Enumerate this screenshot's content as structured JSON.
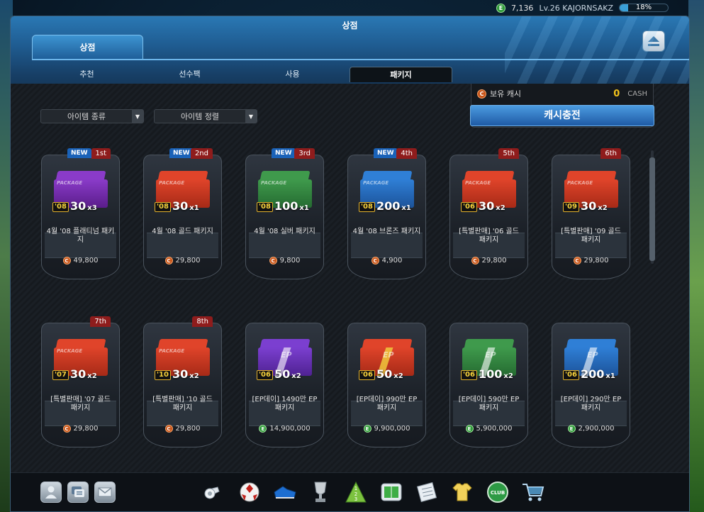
{
  "status": {
    "ep_coin_label": "E",
    "ep_amount": "7,136",
    "level_text": "Lv.26 KAJORNSAKZ",
    "exp_percent_text": "18%",
    "exp_fraction": 0.18
  },
  "window": {
    "title": "상점",
    "main_tab": "상점"
  },
  "sub_tabs": [
    {
      "label": "추천"
    },
    {
      "label": "선수팩"
    },
    {
      "label": "사용"
    },
    {
      "label": "패키지"
    }
  ],
  "filters": {
    "item_type": "아이템 종류",
    "item_sort": "아이템 정렬",
    "arrow": "▼"
  },
  "cash": {
    "coin_label": "C",
    "label": "보유 캐시",
    "amount": "0",
    "unit": "CASH",
    "charge_button": "캐시충전"
  },
  "products": [
    {
      "new": "NEW",
      "rank": "1st",
      "name": "4월 '08 플래티넘 패키지",
      "price": "49,800",
      "currency": "C",
      "year": "'08",
      "qty": "30",
      "mult": "x3",
      "color": "#8a3bc9",
      "color_dark": "#5a1d8a",
      "style": "package"
    },
    {
      "new": "NEW",
      "rank": "2nd",
      "name": "4월 '08 골드 패키지",
      "price": "29,800",
      "currency": "C",
      "year": "'08",
      "qty": "30",
      "mult": "x1",
      "color": "#e0442a",
      "color_dark": "#a62a17",
      "style": "package"
    },
    {
      "new": "NEW",
      "rank": "3rd",
      "name": "4월 '08 실버 패키지",
      "price": "9,800",
      "currency": "C",
      "year": "'08",
      "qty": "100",
      "mult": "x1",
      "color": "#3f9a4c",
      "color_dark": "#256b31",
      "style": "package"
    },
    {
      "new": "NEW",
      "rank": "4th",
      "name": "4월 '08 브론즈 패키지",
      "price": "4,900",
      "currency": "C",
      "year": "'08",
      "qty": "200",
      "mult": "x1",
      "color": "#2f7fd6",
      "color_dark": "#1c539a",
      "style": "package"
    },
    {
      "new": "",
      "rank": "5th",
      "name": "[특별판매] '06 골드 패키지",
      "price": "29,800",
      "currency": "C",
      "year": "'06",
      "qty": "30",
      "mult": "x2",
      "color": "#e0442a",
      "color_dark": "#a62a17",
      "style": "package"
    },
    {
      "new": "",
      "rank": "6th",
      "name": "[특별판매] '09 골드 패키지",
      "price": "29,800",
      "currency": "C",
      "year": "'09",
      "qty": "30",
      "mult": "x2",
      "color": "#e0442a",
      "color_dark": "#a62a17",
      "style": "package"
    },
    {
      "new": "",
      "rank": "7th",
      "name": "[특별판매] '07 골드 패키지",
      "price": "29,800",
      "currency": "C",
      "year": "'07",
      "qty": "30",
      "mult": "x2",
      "color": "#e0442a",
      "color_dark": "#a62a17",
      "style": "package"
    },
    {
      "new": "",
      "rank": "8th",
      "name": "[특별판매] '10 골드 패키지",
      "price": "29,800",
      "currency": "C",
      "year": "'10",
      "qty": "30",
      "mult": "x2",
      "color": "#e0442a",
      "color_dark": "#a62a17",
      "style": "package"
    },
    {
      "new": "",
      "rank": "",
      "name": "[EP데이] 1490만 EP 패키지",
      "price": "14,900,000",
      "currency": "E",
      "year": "'06",
      "qty": "50",
      "mult": "x2",
      "color": "#7b3fd0",
      "color_dark": "#4f2292",
      "style": "ep"
    },
    {
      "new": "",
      "rank": "",
      "name": "[EP데이] 990만 EP 패키지",
      "price": "9,900,000",
      "currency": "E",
      "year": "'06",
      "qty": "50",
      "mult": "x2",
      "color": "#e0442a",
      "color_dark": "#a62a17",
      "style": "ep"
    },
    {
      "new": "",
      "rank": "",
      "name": "[EP데이] 590만 EP 패키지",
      "price": "5,900,000",
      "currency": "E",
      "year": "'06",
      "qty": "100",
      "mult": "x2",
      "color": "#3f9a4c",
      "color_dark": "#256b31",
      "style": "ep"
    },
    {
      "new": "",
      "rank": "",
      "name": "[EP데이] 290만 EP 패키지",
      "price": "2,900,000",
      "currency": "E",
      "year": "'06",
      "qty": "200",
      "mult": "x1",
      "color": "#2f7fd6",
      "color_dark": "#1c539a",
      "style": "ep"
    }
  ],
  "box_texts": {
    "package": "PACKAGE",
    "ep": "EP"
  },
  "bottom_left_icons": [
    "profile-icon",
    "message-list-icon",
    "mail-icon"
  ],
  "bottom_center_icons": [
    "whistle-icon",
    "soccer-ball-icon",
    "boots-icon",
    "trophy-icon",
    "ranking-pyramid-icon",
    "pitch-icon",
    "notepad-icon",
    "jersey-icon",
    "club-badge-icon",
    "shopping-cart-icon"
  ],
  "club_badge_text": "CLUB",
  "pyramid_numbers": [
    "1",
    "2",
    "3"
  ]
}
